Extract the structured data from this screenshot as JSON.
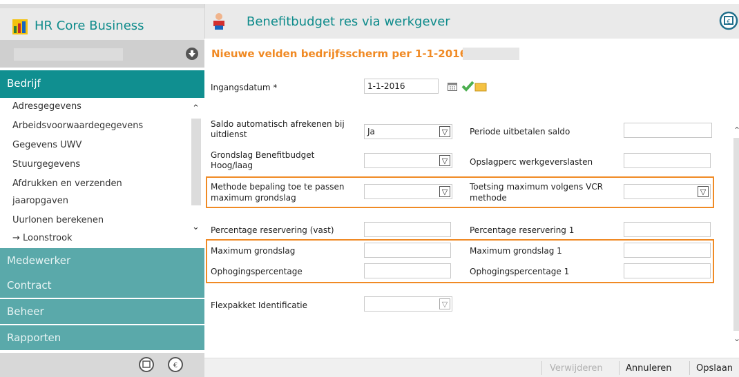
{
  "header": {
    "app_title": "HR Core Business",
    "section_title": "Benefitbudget res via werkgever"
  },
  "page_heading": "Nieuwe velden bedrijfsscherm per 1-1-2016",
  "sidebar": {
    "section_label": "Bedrijf",
    "items": [
      "Adresgegevens",
      "Arbeidsvoorwaardegegevens",
      "Gegevens UWV",
      "Stuurgegevens",
      "Afdrukken en verzenden",
      "jaaropgaven",
      "Uurlonen berekenen",
      "→ Loonstrook"
    ],
    "nav": [
      "Medewerker",
      "Contract",
      "Beheer",
      "Rapporten"
    ]
  },
  "form": {
    "ingangsdatum_label": "Ingangsdatum *",
    "ingangsdatum_value": "1-1-2016",
    "saldo_label_1": "Saldo automatisch afrekenen bij",
    "saldo_label_2": "uitdienst",
    "saldo_value": "Ja",
    "periode_label": "Periode uitbetalen saldo",
    "grondslag_label_1": "Grondslag Benefitbudget",
    "grondslag_label_2": "Hoog/laag",
    "opslag_label": "Opslagperc werkgeverslasten",
    "methode_label_1": "Methode bepaling toe te passen",
    "methode_label_2": "maximum grondslag",
    "toetsing_label_1": "Toetsing maximum volgens VCR",
    "toetsing_label_2": "methode",
    "perc_vast_label": "Percentage reservering (vast)",
    "perc_1_label": "Percentage reservering 1",
    "max_grondslag_label": "Maximum grondslag",
    "max_grondslag_1_label": "Maximum grondslag 1",
    "ophoging_label": "Ophogingspercentage",
    "ophoging_1_label": "Ophogingspercentage 1",
    "flexpakket_label": "Flexpakket Identificatie"
  },
  "footer": {
    "delete": "Verwijderen",
    "cancel": "Annuleren",
    "save": "Opslaan"
  },
  "colors": {
    "accent": "#0e8b8b",
    "highlight": "#f08a24",
    "heading": "#f08a24"
  }
}
